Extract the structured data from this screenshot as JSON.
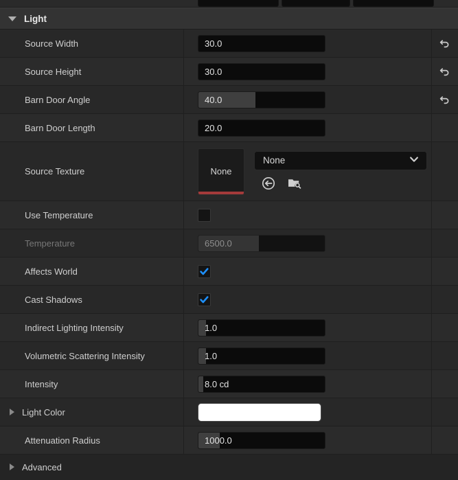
{
  "panel": {
    "category": {
      "title": "Light",
      "expanded": true,
      "expand_icon": "triangle-down-icon"
    },
    "advanced": {
      "label": "Advanced",
      "expanded": false,
      "expand_icon": "triangle-right-icon"
    }
  },
  "colors": {
    "accent_check": "#1e90ff",
    "thumb_bar": "#a33a3a",
    "light_color_swatch": "#ffffff",
    "header_bg": "#333333",
    "row_bg": "#282828"
  },
  "rows": [
    {
      "id": "source-width",
      "label": "Source Width",
      "type": "number",
      "value": "30.0",
      "fill_pct": 0,
      "reset_icon": "reset-arrow-icon",
      "has_reset": true
    },
    {
      "id": "source-height",
      "label": "Source Height",
      "type": "number",
      "value": "30.0",
      "fill_pct": 0,
      "reset_icon": "reset-arrow-icon",
      "has_reset": true
    },
    {
      "id": "barn-door-angle",
      "label": "Barn Door Angle",
      "type": "number",
      "value": "40.0",
      "fill_pct": 45,
      "reset_icon": "reset-arrow-icon",
      "has_reset": true
    },
    {
      "id": "barn-door-length",
      "label": "Barn Door Length",
      "type": "number",
      "value": "20.0",
      "fill_pct": 0,
      "has_reset": false
    },
    {
      "id": "source-texture",
      "label": "Source Texture",
      "type": "asset",
      "thumbnail_text": "None",
      "combo_value": "None",
      "combo_icon": "chevron-down-icon",
      "use_selected_icon": "use-selected-asset-icon",
      "browse_icon": "browse-to-asset-icon",
      "has_reset": false
    },
    {
      "id": "use-temperature",
      "label": "Use Temperature",
      "type": "checkbox",
      "checked": false,
      "has_reset": false
    },
    {
      "id": "temperature",
      "label": "Temperature",
      "type": "number",
      "value": "6500.0",
      "fill_pct": 48,
      "disabled": true,
      "has_reset": false
    },
    {
      "id": "affects-world",
      "label": "Affects World",
      "type": "checkbox",
      "checked": true,
      "check_icon": "checkmark-icon",
      "has_reset": false
    },
    {
      "id": "cast-shadows",
      "label": "Cast Shadows",
      "type": "checkbox",
      "checked": true,
      "check_icon": "checkmark-icon",
      "has_reset": false
    },
    {
      "id": "indirect-lighting-intensity",
      "label": "Indirect Lighting Intensity",
      "type": "number",
      "value": "1.0",
      "fill_pct": 6,
      "has_reset": false
    },
    {
      "id": "volumetric-scattering-intensity",
      "label": "Volumetric Scattering Intensity",
      "type": "number",
      "value": "1.0",
      "fill_pct": 6,
      "has_reset": false
    },
    {
      "id": "intensity",
      "label": "Intensity",
      "type": "number",
      "value": "8.0 cd",
      "fill_pct": 4,
      "has_reset": false
    },
    {
      "id": "light-color",
      "label": "Light Color",
      "type": "color",
      "swatch": "#ffffff",
      "expandable": true,
      "expand_icon": "triangle-right-icon",
      "has_reset": false
    },
    {
      "id": "attenuation-radius",
      "label": "Attenuation Radius",
      "type": "number",
      "value": "1000.0",
      "fill_pct": 17,
      "has_reset": false
    }
  ]
}
